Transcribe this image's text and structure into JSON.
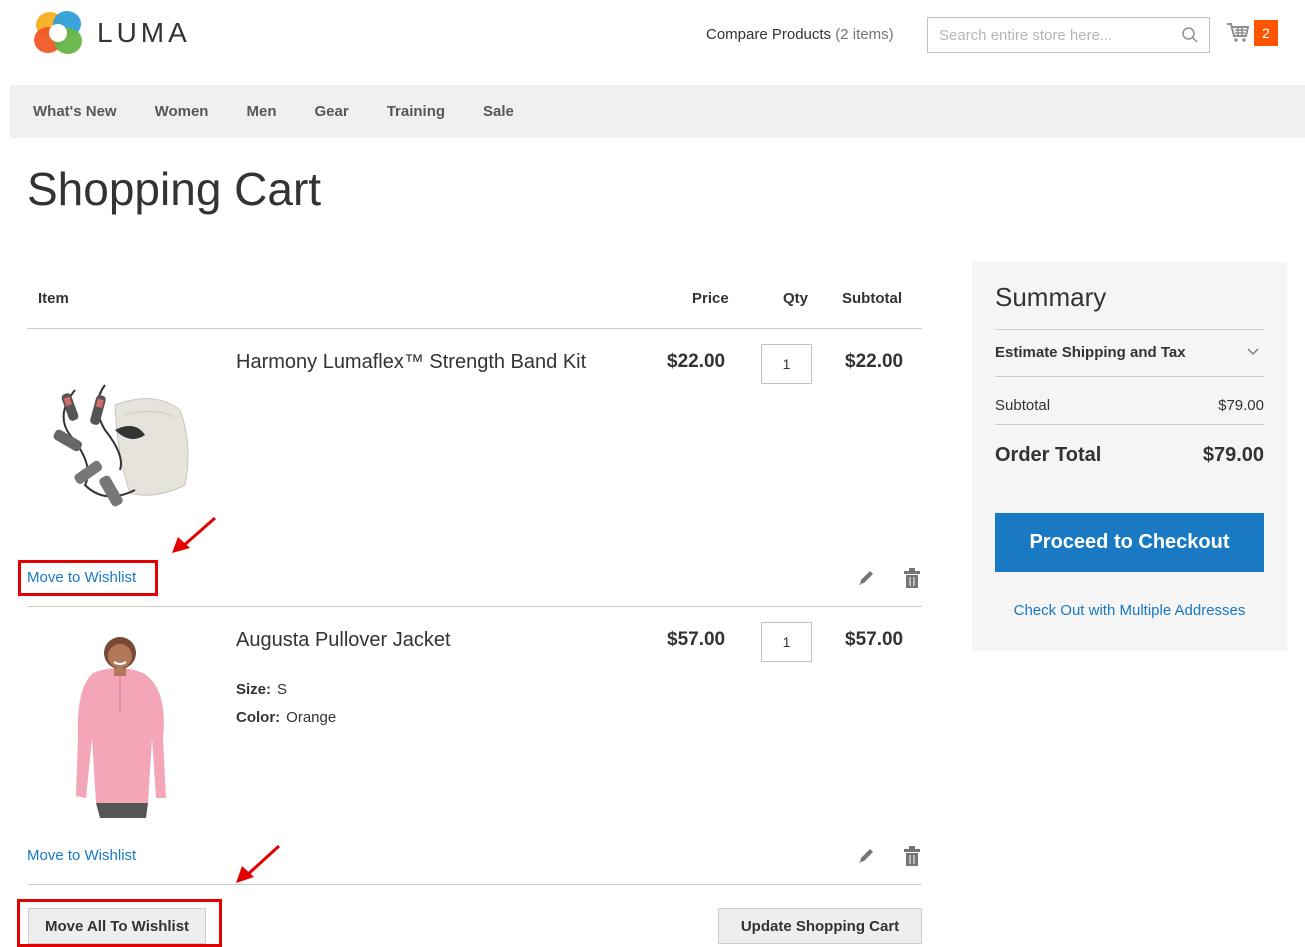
{
  "header": {
    "logo_text": "LUMA",
    "compare_label": "Compare Products",
    "compare_count": "(2 items)",
    "search_placeholder": "Search entire store here...",
    "cart_count": "2"
  },
  "nav": [
    "What's New",
    "Women",
    "Men",
    "Gear",
    "Training",
    "Sale"
  ],
  "page_title": "Shopping Cart",
  "cart": {
    "columns": {
      "item": "Item",
      "price": "Price",
      "qty": "Qty",
      "subtotal": "Subtotal"
    },
    "items": [
      {
        "name": "Harmony Lumaflex™ Strength Band Kit",
        "price": "$22.00",
        "qty": "1",
        "subtotal": "$22.00",
        "wishlist_label": "Move to Wishlist",
        "options": []
      },
      {
        "name": "Augusta Pullover Jacket",
        "price": "$57.00",
        "qty": "1",
        "subtotal": "$57.00",
        "wishlist_label": "Move to Wishlist",
        "options": [
          {
            "label": "Size:",
            "value": "S"
          },
          {
            "label": "Color:",
            "value": "Orange"
          }
        ]
      }
    ],
    "move_all_label": "Move All To Wishlist",
    "update_label": "Update Shopping Cart"
  },
  "summary": {
    "title": "Summary",
    "estimate_label": "Estimate Shipping and Tax",
    "subtotal_label": "Subtotal",
    "subtotal_value": "$79.00",
    "order_total_label": "Order Total",
    "order_total_value": "$79.00",
    "checkout_label": "Proceed to Checkout",
    "multi_label": "Check Out with Multiple Addresses"
  },
  "colors": {
    "accent": "#1979c3",
    "cart_badge": "#ff5501",
    "annotation": "#e30000"
  },
  "icons": [
    "luma-logo-icon",
    "search-icon",
    "cart-icon",
    "edit-icon",
    "trash-icon",
    "chevron-down-icon"
  ]
}
